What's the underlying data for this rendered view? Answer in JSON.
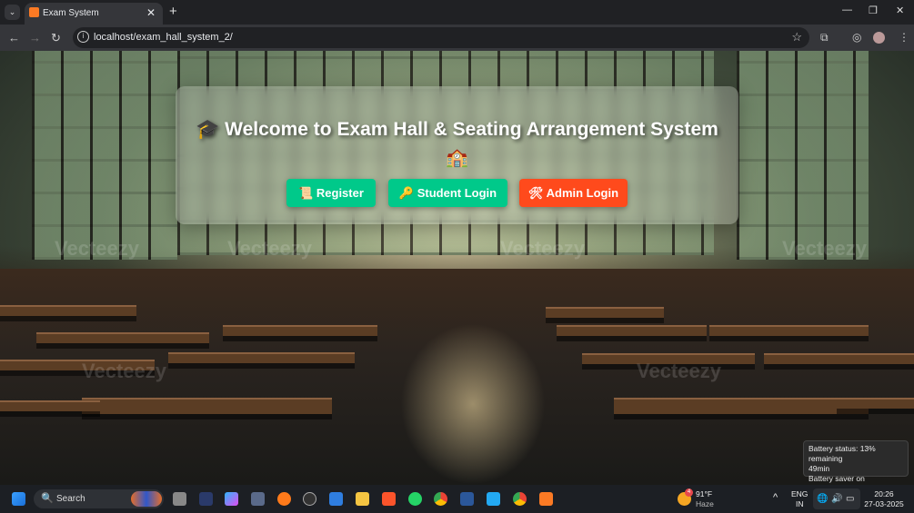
{
  "browser": {
    "tab_title": "Exam System",
    "url": "localhost/exam_hall_system_2/"
  },
  "page": {
    "title": "Welcome to Exam Hall & Seating Arrangement System",
    "title_emoji": "🎓",
    "school_emoji": "🏫",
    "buttons": [
      {
        "icon": "📜",
        "label": "Register"
      },
      {
        "icon": "🔑",
        "label": "Student Login"
      },
      {
        "icon": "🛠",
        "label": "Admin Login"
      }
    ],
    "watermark": "Vecteezy"
  },
  "colors": {
    "green": "#00c98a",
    "red": "#ff4a1c"
  },
  "tooltip": {
    "line1": "Battery status: 13% remaining",
    "line2": "49min",
    "line3": "Battery saver on"
  },
  "taskbar": {
    "search": "Search",
    "weather_temp": "91°F",
    "weather_desc": "Haze",
    "weather_badge": "4",
    "lang1": "ENG",
    "lang2": "IN",
    "time": "20:26",
    "date": "27-03-2025"
  }
}
